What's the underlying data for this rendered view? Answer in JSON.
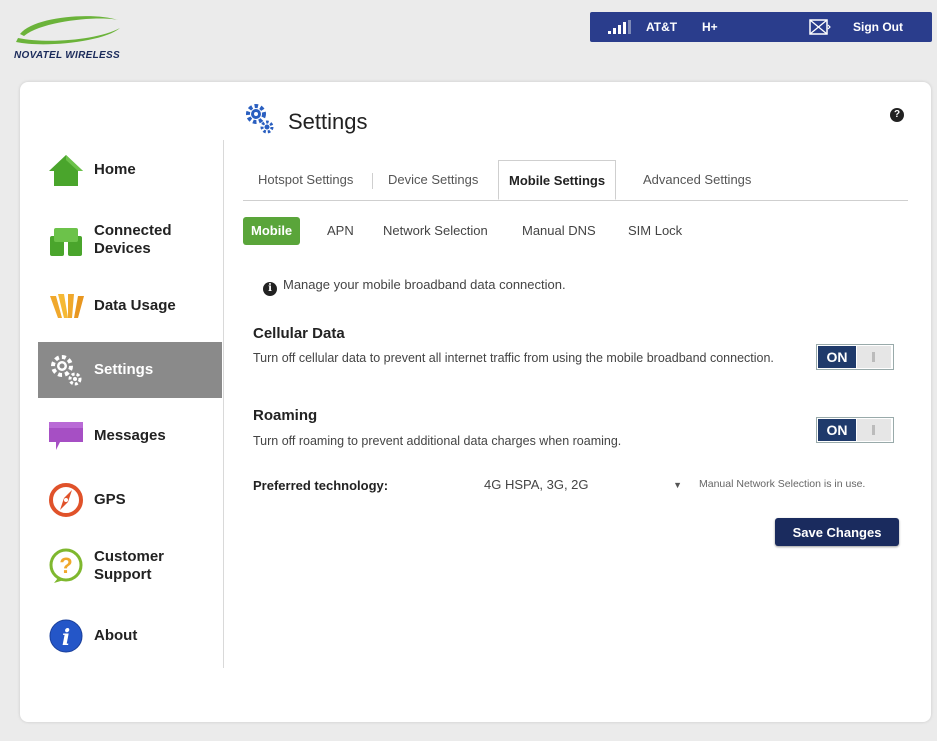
{
  "brand": {
    "name": "NOVATEL WIRELESS"
  },
  "status_bar": {
    "carrier": "AT&T",
    "network_type": "H+",
    "sign_out_label": "Sign Out",
    "color": "#2a3d8c"
  },
  "page": {
    "title": "Settings"
  },
  "sidebar": {
    "items": [
      {
        "label": "Home",
        "icon": "home-icon"
      },
      {
        "label": "Connected Devices",
        "icon": "connected-devices-icon"
      },
      {
        "label": "Data Usage",
        "icon": "data-usage-icon"
      },
      {
        "label": "Settings",
        "icon": "settings-gear-icon",
        "active": true
      },
      {
        "label": "Messages",
        "icon": "messages-icon"
      },
      {
        "label": "GPS",
        "icon": "gps-compass-icon"
      },
      {
        "label": "Customer Support",
        "icon": "support-question-icon"
      },
      {
        "label": "About",
        "icon": "info-icon"
      }
    ]
  },
  "tabs": [
    {
      "label": "Hotspot Settings"
    },
    {
      "label": "Device Settings"
    },
    {
      "label": "Mobile Settings",
      "active": true
    },
    {
      "label": "Advanced Settings"
    }
  ],
  "subtabs": [
    {
      "label": "Mobile",
      "active": true
    },
    {
      "label": "APN"
    },
    {
      "label": "Network Selection"
    },
    {
      "label": "Manual DNS"
    },
    {
      "label": "SIM Lock"
    }
  ],
  "info_text": "Manage your mobile broadband data connection.",
  "cellular_data": {
    "title": "Cellular Data",
    "description": "Turn off cellular data to prevent all internet traffic from using the mobile broadband connection.",
    "toggle_label": "ON"
  },
  "roaming": {
    "title": "Roaming",
    "description": "Turn off roaming to prevent additional data charges when roaming.",
    "toggle_label": "ON"
  },
  "preferred_technology": {
    "label": "Preferred technology:",
    "value": "4G HSPA, 3G, 2G",
    "note": "Manual Network Selection is in use."
  },
  "save_button_label": "Save Changes",
  "colors": {
    "accent_green": "#5aa53a",
    "toggle_on": "#1f3a6b",
    "save_button": "#1a2b5e",
    "sidebar_active": "#8a8a8a"
  }
}
